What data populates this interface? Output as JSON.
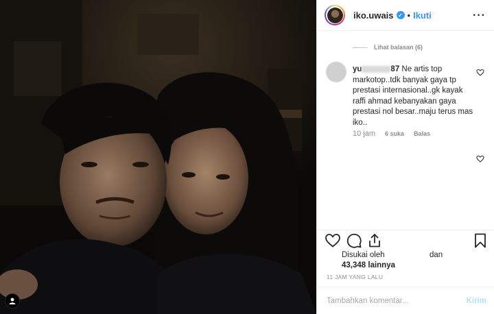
{
  "header": {
    "username": "iko.uwais",
    "dot": "•",
    "follow_label": "Ikuti",
    "more_label": "···"
  },
  "comments": {
    "view_replies_label": "Lihat balasan (6)",
    "item": {
      "user_prefix": "yu",
      "user_suffix": "87",
      "text": "Ne artis top markotop..tdk banyak gaya tp prestasi internasional..gk kayak raffi ahmad kebanyakan gaya prestasi nol besar..maju terus mas iko..",
      "time": "10 jam",
      "likes": "6 suka",
      "reply_label": "Balas"
    }
  },
  "likes": {
    "liked_by_label": "Disukai oleh",
    "and_label": "dan",
    "count_label": "43,348 lainnya"
  },
  "timestamp": "11 JAM YANG LALU",
  "comment_box": {
    "placeholder": "Tambahkan komentar...",
    "post_label": "Kirim"
  },
  "colors": {
    "link": "#3897f0",
    "post_disabled": "#b2dffc",
    "muted": "#8e8e8e"
  },
  "icons": [
    "heart-icon",
    "comment-icon",
    "share-icon",
    "bookmark-icon",
    "user-tag-icon",
    "more-icon",
    "verified-icon"
  ]
}
